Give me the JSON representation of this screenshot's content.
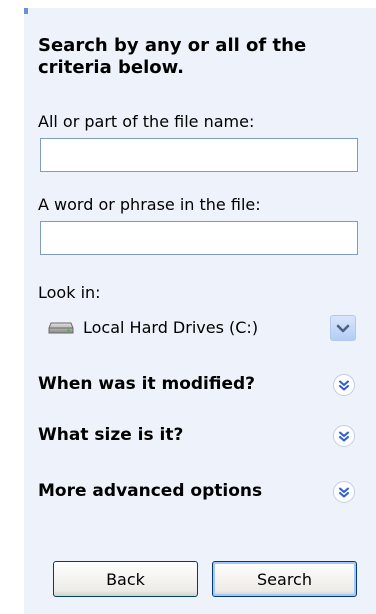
{
  "search_panel": {
    "heading": "Search by any or all of the criteria below.",
    "file_name_label": "All or part of the file name:",
    "file_name_value": "",
    "phrase_label": "A word or phrase in the file:",
    "phrase_value": "",
    "look_in_label": "Look in:",
    "look_in_selected": "Local Hard Drives (C:)",
    "sections": [
      {
        "label": "When was it modified?",
        "icon": "expand-chevron-icon"
      },
      {
        "label": "What size is it?",
        "icon": "expand-chevron-icon"
      },
      {
        "label": "More advanced options",
        "icon": "expand-chevron-icon"
      }
    ],
    "buttons": {
      "back": "Back",
      "search": "Search"
    }
  },
  "colors": {
    "panel_bg": "#eef3fb",
    "accent": "#2d5cd4",
    "input_border": "#7f9db9",
    "button_border": "#003c74"
  }
}
